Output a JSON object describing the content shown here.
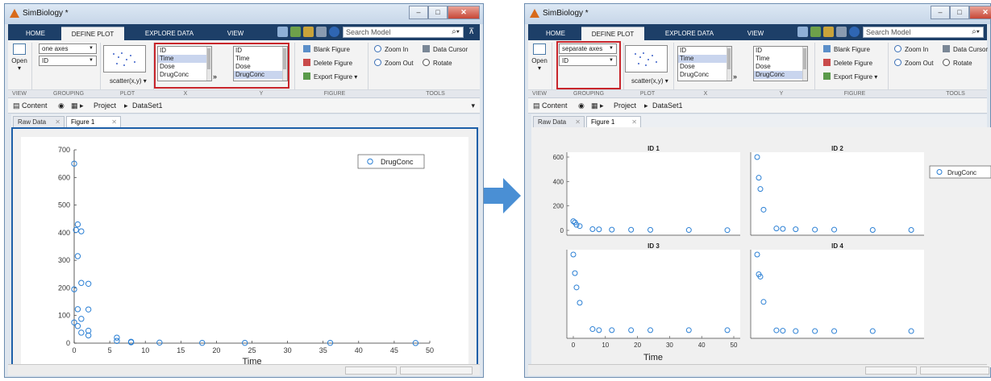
{
  "left": {
    "title": "SimBiology *",
    "ribbon_tabs": [
      "HOME",
      "DEFINE PLOT",
      "EXPLORE DATA",
      "VIEW"
    ],
    "search_placeholder": "Search Model",
    "open_label": "Open",
    "axes_select": "one axes",
    "group_select": "ID",
    "plot_type": "scatter(x,y)",
    "x_list": [
      "ID",
      "Time",
      "Dose",
      "DrugConc"
    ],
    "y_list": [
      "ID",
      "Time",
      "Dose",
      "DrugConc"
    ],
    "figure_actions": [
      "Blank Figure",
      "Delete Figure",
      "Export Figure"
    ],
    "tool_actions": [
      "Zoom In",
      "Zoom Out",
      "Data Cursor",
      "Rotate"
    ],
    "group_labels": [
      "VIEW",
      "GROUPING",
      "PLOT",
      "X",
      "Y",
      "FIGURE",
      "TOOLS"
    ],
    "crumb_content": "Content",
    "crumb_project": "Project",
    "crumb_dataset": "DataSet1",
    "doc_tabs": [
      "Raw Data",
      "Figure 1"
    ]
  },
  "right": {
    "title": "SimBiology *",
    "ribbon_tabs": [
      "HOME",
      "DEFINE PLOT",
      "EXPLORE DATA",
      "VIEW"
    ],
    "search_placeholder": "Search Model",
    "open_label": "Open",
    "axes_select": "separate axes",
    "group_select": "ID",
    "plot_type": "scatter(x,y)",
    "x_list": [
      "ID",
      "Time",
      "Dose",
      "DrugConc"
    ],
    "y_list": [
      "ID",
      "Time",
      "Dose",
      "DrugConc"
    ],
    "figure_actions": [
      "Blank Figure",
      "Delete Figure",
      "Export Figure"
    ],
    "tool_actions": [
      "Zoom In",
      "Zoom Out",
      "Data Cursor",
      "Rotate"
    ],
    "group_labels": [
      "VIEW",
      "GROUPING",
      "PLOT",
      "X",
      "Y",
      "FIGURE",
      "TOOLS"
    ],
    "crumb_content": "Content",
    "crumb_project": "Project",
    "crumb_dataset": "DataSet1",
    "doc_tabs": [
      "Raw Data",
      "Figure 1"
    ]
  },
  "colors": {
    "marker": "#2a7fd4",
    "highlight_box": "#c8252b",
    "figure_border": "#1d5fa8",
    "tabstrip": "#1d3f68"
  },
  "chart_data": [
    {
      "type": "scatter",
      "xlabel": "Time",
      "ylabel": "",
      "xlim": [
        0,
        50
      ],
      "ylim": [
        0,
        700
      ],
      "xticks": [
        0,
        5,
        10,
        15,
        20,
        25,
        30,
        35,
        40,
        45,
        50
      ],
      "yticks": [
        0,
        100,
        200,
        300,
        400,
        500,
        600,
        700
      ],
      "legend": "DrugConc",
      "legend_position": "top-right",
      "points": [
        [
          0,
          650
        ],
        [
          0.25,
          410
        ],
        [
          0.5,
          430
        ],
        [
          1,
          405
        ],
        [
          0.5,
          315
        ],
        [
          0,
          195
        ],
        [
          1,
          218
        ],
        [
          2,
          215
        ],
        [
          0.5,
          123
        ],
        [
          2,
          122
        ],
        [
          1,
          88
        ],
        [
          0,
          75
        ],
        [
          0.5,
          62
        ],
        [
          1,
          38
        ],
        [
          2,
          45
        ],
        [
          2,
          28
        ],
        [
          6,
          20
        ],
        [
          6,
          8
        ],
        [
          8,
          5
        ],
        [
          8,
          3
        ],
        [
          12,
          2
        ],
        [
          18,
          1
        ],
        [
          24,
          1
        ],
        [
          36,
          1
        ],
        [
          48,
          0.5
        ]
      ]
    },
    {
      "type": "scatter",
      "xlabel": "Time",
      "layout": "2x2 separate axes",
      "legend": "DrugConc",
      "legend_position": "top-right",
      "xticks": [
        0,
        10,
        20,
        30,
        40,
        50
      ],
      "yticks": [
        0,
        200,
        400,
        600
      ],
      "panels": [
        {
          "title": "ID 1",
          "points": [
            [
              0,
              75
            ],
            [
              0.5,
              65
            ],
            [
              1,
              45
            ],
            [
              2,
              35
            ],
            [
              6,
              10
            ],
            [
              8,
              8
            ],
            [
              12,
              6
            ],
            [
              18,
              5
            ],
            [
              24,
              4
            ],
            [
              36,
              3
            ],
            [
              48,
              2
            ]
          ]
        },
        {
          "title": "ID 2",
          "points": [
            [
              0,
              195
            ],
            [
              0.5,
              140
            ],
            [
              1,
              110
            ],
            [
              2,
              55
            ],
            [
              6,
              5
            ],
            [
              8,
              4
            ],
            [
              12,
              3
            ],
            [
              18,
              2
            ],
            [
              24,
              2
            ],
            [
              36,
              1
            ],
            [
              48,
              1
            ]
          ]
        },
        {
          "title": "ID 3",
          "points": [
            [
              0,
              0.72
            ],
            [
              0.5,
              0.55
            ],
            [
              1,
              0.42
            ],
            [
              2,
              0.28
            ],
            [
              6,
              0.04
            ],
            [
              8,
              0.03
            ],
            [
              12,
              0.03
            ],
            [
              18,
              0.03
            ],
            [
              24,
              0.03
            ],
            [
              36,
              0.03
            ],
            [
              48,
              0.03
            ]
          ]
        },
        {
          "title": "ID 4",
          "points": [
            [
              0,
              1.0
            ],
            [
              0.5,
              0.75
            ],
            [
              1,
              0.72
            ],
            [
              2,
              0.4
            ],
            [
              6,
              0.04
            ],
            [
              8,
              0.035
            ],
            [
              12,
              0.03
            ],
            [
              18,
              0.03
            ],
            [
              24,
              0.03
            ],
            [
              36,
              0.03
            ],
            [
              48,
              0.03
            ]
          ]
        }
      ]
    }
  ]
}
